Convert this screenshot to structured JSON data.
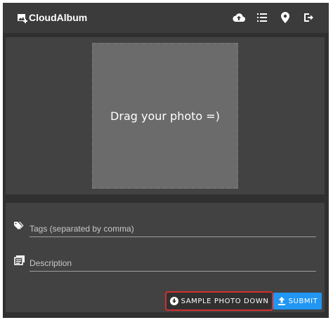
{
  "app_bar": {
    "title": "CloudAlbum",
    "icons": [
      "add-photo-icon",
      "cloud-upload-icon",
      "list-icon",
      "location-pin-icon",
      "sign-out-icon"
    ]
  },
  "upload": {
    "dropzone_text": "Drag your photo =)"
  },
  "form": {
    "tags_placeholder": "Tags (separated by comma)",
    "tags_value": "",
    "description_placeholder": "Description",
    "description_value": "",
    "icons": [
      "tag-icon",
      "description-icon"
    ]
  },
  "actions": {
    "sample_photo_label": "SAMPLE PHOTO DOWN",
    "submit_label": "SUBMIT"
  },
  "colors": {
    "background": "#303030",
    "panel": "#424242",
    "dropzone": "#6b6b6b",
    "primary": "#2196f3",
    "highlight": "#d32f2f",
    "text": "#ffffff"
  }
}
